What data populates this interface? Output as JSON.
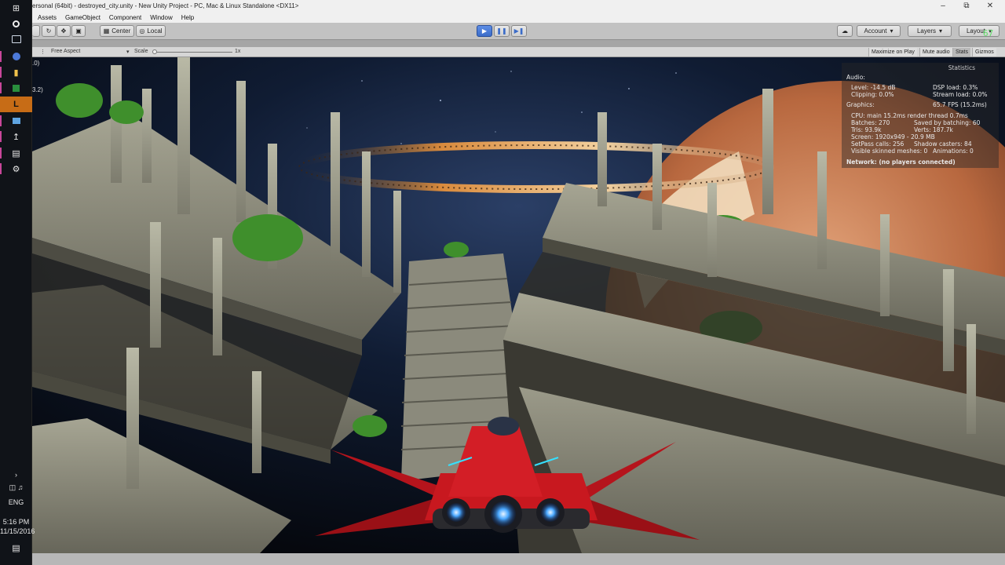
{
  "title": "ersonal (64bit) - destroyed_city.unity - New Unity Project - PC, Mac & Linux Standalone <DX11>",
  "menu": [
    "Assets",
    "GameObject",
    "Component",
    "Window",
    "Help"
  ],
  "toolbar": {
    "pivot": "Center",
    "space": "Local",
    "account": "Account",
    "layers": "Layers",
    "layout": "Layout"
  },
  "gameview": {
    "aspect": "Free Aspect",
    "scale_label": "Scale",
    "scale_value": "1x",
    "maximize": "Maximize on Play",
    "mute": "Mute audio",
    "stats": "Stats",
    "gizmos": "Gizmos"
  },
  "side_values": [
    ".0)",
    "3.2)"
  ],
  "stats": {
    "title": "Statistics",
    "audio_header": "Audio:",
    "level": "Level: -14.5 dB",
    "clipping": "Clipping: 0.0%",
    "dsp": "DSP load: 0.3%",
    "stream": "Stream load: 0.0%",
    "graphics_header": "Graphics:",
    "fps": "65.7 FPS (15.2ms)",
    "cpu": "CPU: main 15.2ms  render thread 0.7ms",
    "batches": "Batches: 270",
    "saved": "Saved by batching: 60",
    "tris": "Tris: 93.9k",
    "verts": "Verts: 187.7k",
    "screen": "Screen: 1920x949 - 20.9 MB",
    "setpass": "SetPass calls: 256",
    "shadow": "Shadow casters: 84",
    "skinned": "Visible skinned meshes: 0",
    "animations": "Animations: 0",
    "network": "Network: (no players connected)"
  },
  "tray": {
    "lang": "ENG",
    "time": "5:16 PM",
    "date": "11/15/2016"
  },
  "overlay_fps": "67",
  "colors": {
    "play_accent": "#3b6cc8",
    "taskbar": "#101318",
    "highlight": "#c76c16",
    "overlay_green": "#62e06c"
  }
}
